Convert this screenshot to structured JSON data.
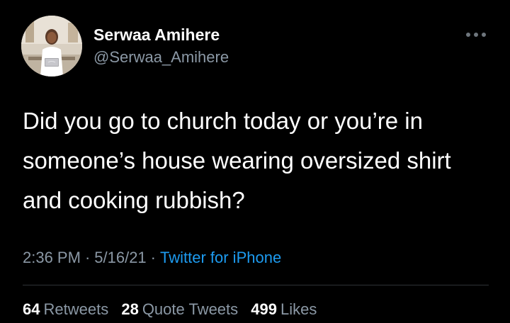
{
  "author": {
    "display_name": "Serwaa Amihere",
    "handle": "@Serwaa_Amihere",
    "avatar_icon": "profile-photo"
  },
  "menu": {
    "icon": "more-horizontal-icon"
  },
  "tweet": {
    "text": "Did you go to church today or you’re in someone’s house wearing oversized shirt and cooking rubbish?"
  },
  "meta": {
    "time": "2:36 PM",
    "date": "5/16/21",
    "source": "Twitter for iPhone"
  },
  "stats": {
    "retweets_count": "64",
    "retweets_label": "Retweets",
    "quotes_count": "28",
    "quotes_label": "Quote Tweets",
    "likes_count": "499",
    "likes_label": "Likes"
  },
  "colors": {
    "background": "#000000",
    "text": "#ffffff",
    "secondary": "#8b98a5",
    "link": "#1d9bf0",
    "divider": "#2f3336"
  }
}
